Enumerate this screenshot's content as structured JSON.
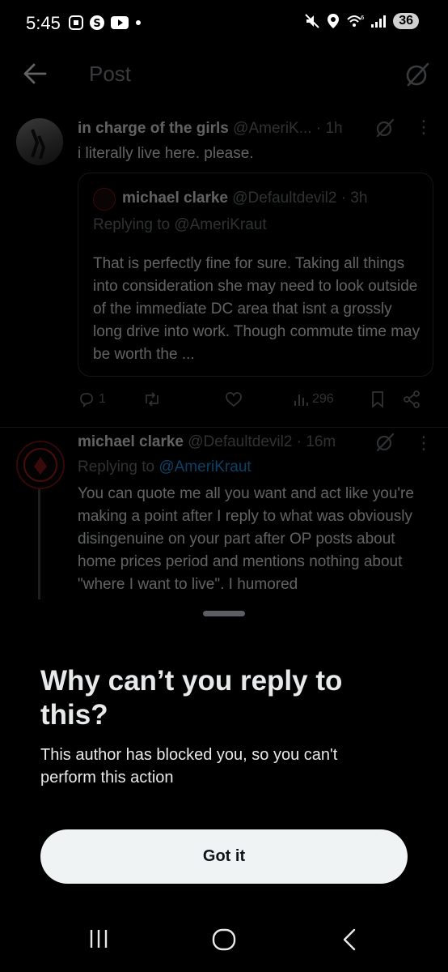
{
  "status_bar": {
    "time": "5:45",
    "battery": "36",
    "icons_left": [
      "screenshot-icon",
      "s-app-icon",
      "youtube-icon",
      "dot-icon"
    ],
    "icons_right": [
      "mute-icon",
      "location-icon",
      "wifi-6-icon",
      "signal-icon",
      "battery-icon"
    ]
  },
  "header": {
    "title": "Post"
  },
  "posts": [
    {
      "name": "in charge of the girls",
      "handle": "@AmeriK...",
      "time": "· 1h",
      "text": "i literally live here. please.",
      "quote": {
        "name": "michael clarke",
        "handle": "@Defaultdevil2",
        "time": "· 3h",
        "replying_prefix": "Replying to ",
        "replying_handle": "@AmeriKraut",
        "text": "That is perfectly fine for sure. Taking all things into consideration she may need to look outside of the immediate DC area that isnt a grossly long drive into work. Though commute time may be worth the ..."
      },
      "stats": {
        "replies": "1",
        "views": "296"
      }
    },
    {
      "name": "michael clarke",
      "handle": "@Defaultdevil2",
      "time": "· 16m",
      "replying_prefix": "Replying to ",
      "replying_handle": "@AmeriKraut",
      "text": "You can quote me all you want and act like you're making a point after I reply to what was obviously disingenuine on your part after OP posts about home prices period and mentions nothing about \"where I want to live\". I humored"
    }
  ],
  "sheet": {
    "title": "Why can’t you reply to this?",
    "description": "This author has blocked you, so you can't perform this action",
    "button_label": "Got it"
  },
  "colors": {
    "background": "#000000",
    "text": "#e7e9ea",
    "muted": "#71767b",
    "link": "#1d9bf0",
    "button_bg": "#eff3f4"
  }
}
